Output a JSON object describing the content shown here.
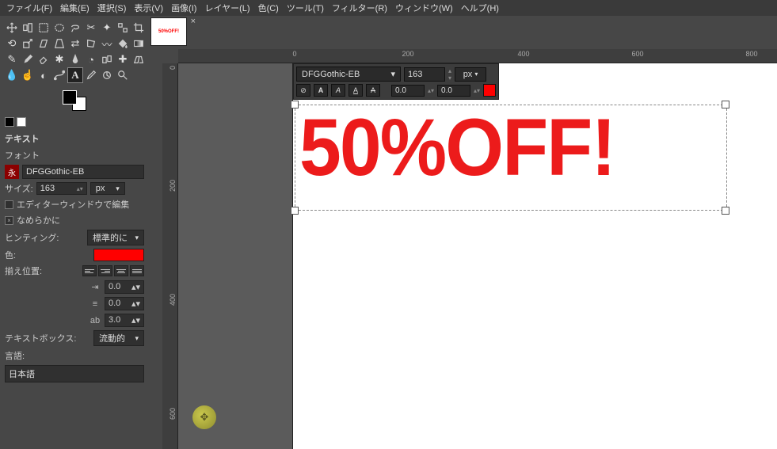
{
  "menus": [
    "ファイル(F)",
    "編集(E)",
    "選択(S)",
    "表示(V)",
    "画像(I)",
    "レイヤー(L)",
    "色(C)",
    "ツール(T)",
    "フィルター(R)",
    "ウィンドウ(W)",
    "ヘルプ(H)"
  ],
  "thumb_text": "50%OFF!",
  "tooloptions": {
    "title": "テキスト",
    "font_label": "フォント",
    "font_value": "DFGGothic-EB",
    "size_label": "サイズ:",
    "size_value": "163",
    "size_unit": "px",
    "editor_chk": "エディターウィンドウで編集",
    "smooth_chk": "なめらかに",
    "hinting_label": "ヒンティング:",
    "hinting_value": "標準的に",
    "color_label": "色:",
    "justify_label": "揃え位置:",
    "indent": "0.0",
    "linespace": "0.0",
    "letterspace": "3.0",
    "textbox_label": "テキストボックス:",
    "textbox_value": "流動的",
    "lang_label": "言語:",
    "lang_value": "日本語"
  },
  "canvas_text": "50%OFF!",
  "floatbar": {
    "font": "DFGGothic-EB",
    "size": "163",
    "unit": "px",
    "kern": "0.0",
    "baseline": "0.0"
  },
  "ruler_marks": [
    "0",
    "200",
    "400",
    "600",
    "800"
  ],
  "colors": {
    "accent": "#ec1b1b",
    "swatch": "#f00"
  }
}
